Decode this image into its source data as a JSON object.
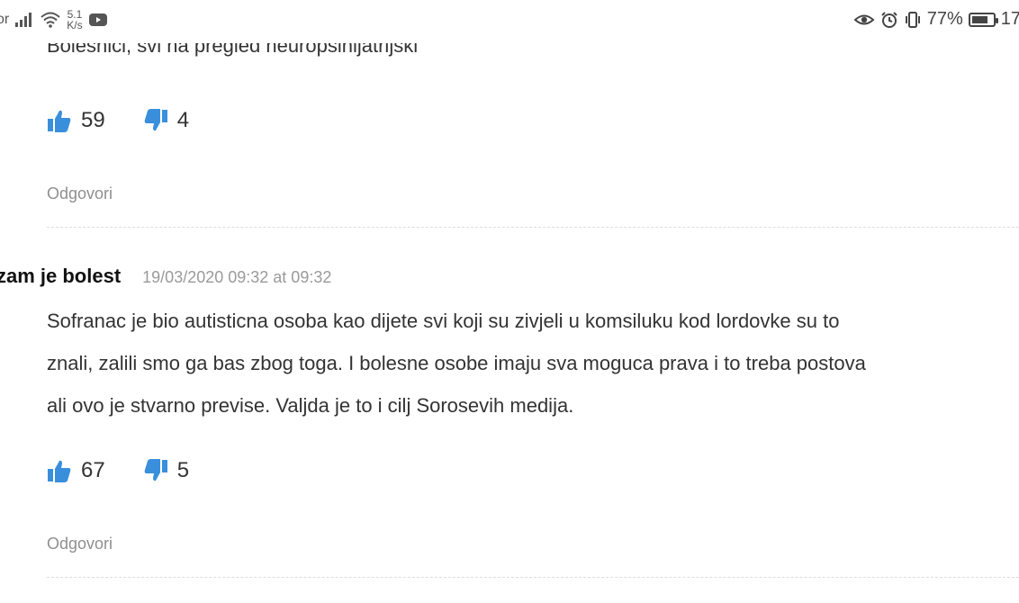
{
  "status_bar": {
    "carrier_fragment": "or",
    "net_speed_value": "5.1",
    "net_speed_unit": "K/s",
    "battery_percent": "77%",
    "battery_level": 0.77,
    "time_fragment": "17"
  },
  "comments": [
    {
      "body_fragment": "Bolesnici, svi na pregled neuropsihijatrijski",
      "likes": "59",
      "dislikes": "4",
      "reply_label": "Odgovori"
    },
    {
      "author": "zam je bolest",
      "date": "19/03/2020 09:32 at 09:32",
      "body_lines": [
        "Sofranac je bio autisticna osoba kao dijete svi koji su zivjeli u komsiluku kod lordovke su to",
        "znali, zalili smo ga bas zbog toga. I bolesne osobe imaju sva moguca prava i to treba postova",
        "ali ovo je stvarno previse. Valjda je to i cilj Sorosevih medija."
      ],
      "likes": "67",
      "dislikes": "5",
      "reply_label": "Odgovori"
    }
  ],
  "colors": {
    "accent_thumb": "#3a8fdc",
    "reply_text": "#8f8f8f",
    "date_text": "#9a9a9a"
  }
}
